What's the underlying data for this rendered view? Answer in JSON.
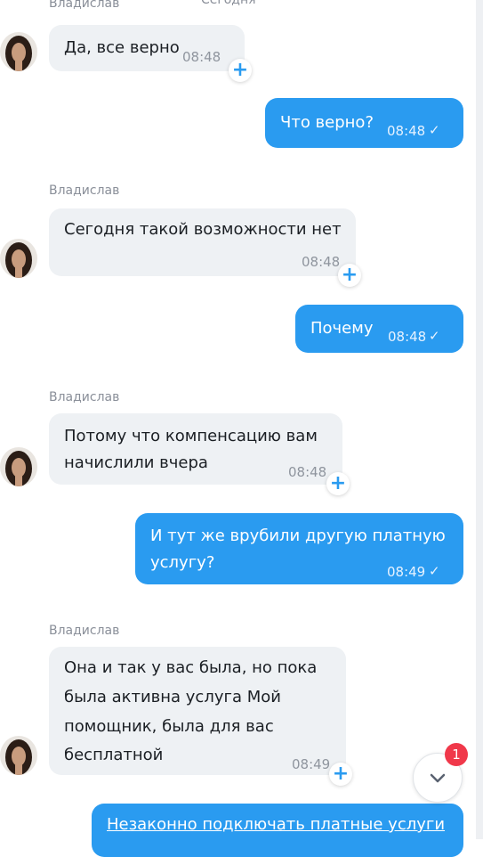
{
  "date_label": "Сегодня",
  "sender_name": "Владислав",
  "messages": [
    {
      "lines": [
        "Да, все верно"
      ],
      "time": "08:48"
    },
    {
      "lines": [
        "Что верно?"
      ],
      "time": "08:48"
    },
    {
      "lines": [
        "Сегодня такой возможности нет"
      ],
      "time": "08:48"
    },
    {
      "lines": [
        "Почему"
      ],
      "time": "08:48"
    },
    {
      "lines": [
        "Потому что компенсацию вам",
        "начислили вчера"
      ],
      "time": "08:48"
    },
    {
      "lines": [
        "И тут же врубили другую платную",
        "услугу?"
      ],
      "time": "08:49"
    },
    {
      "lines": [
        "Она и так у вас была, но пока",
        "была активна услуга Мой",
        "помощник, была для вас",
        "бесплатной"
      ],
      "time": "08:49"
    },
    {
      "lines": [
        "Незаконно подключать платные услуги"
      ]
    }
  ],
  "reaction_plus": "+",
  "unread_badge": "1",
  "icons": {
    "read": "check-icon",
    "scroll": "chevron-down-icon",
    "react": "plus-icon"
  },
  "colors": {
    "outgoing": "#2a9bf0",
    "incoming": "#eef1f4",
    "badge": "#f0384a"
  }
}
